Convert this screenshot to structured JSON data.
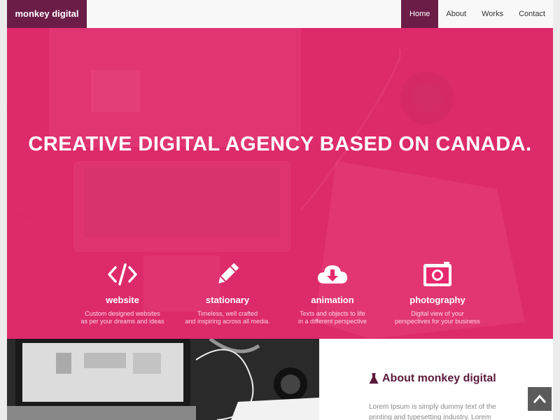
{
  "nav": {
    "brand": "monkey digital",
    "items": [
      {
        "label": "Home",
        "active": true
      },
      {
        "label": "Works",
        "active": false
      },
      {
        "label": "About",
        "active": false
      },
      {
        "label": "Contact",
        "active": false
      }
    ]
  },
  "hero": {
    "headline": "CREATIVE DIGITAL AGENCY BASED ON CANADA.",
    "services": [
      {
        "icon": "code-icon",
        "title": "website",
        "desc_line1": "Custom designed websites",
        "desc_line2": "as per your dreams and ideas"
      },
      {
        "icon": "pencil-icon",
        "title": "stationary",
        "desc_line1": "Timeless, well crafted",
        "desc_line2": "and inspiring across all media."
      },
      {
        "icon": "cloud-download-icon",
        "title": "animation",
        "desc_line1": "Texts and objects to life",
        "desc_line2": "in a different perspective"
      },
      {
        "icon": "camera-icon",
        "title": "photography",
        "desc_line1": "Digital view of your",
        "desc_line2": "perspectives for your business"
      }
    ]
  },
  "about": {
    "heading": "About monkey digital",
    "body": "Lorem Ipsum is simply dummy text of the printing and typesetting industry. Lorem Ipsum"
  },
  "colors": {
    "brand": "#6b1d48",
    "hero_pink": "#f0266e",
    "about_heading": "#5a1a3d",
    "to_top_bg": "#5b5b5b"
  }
}
